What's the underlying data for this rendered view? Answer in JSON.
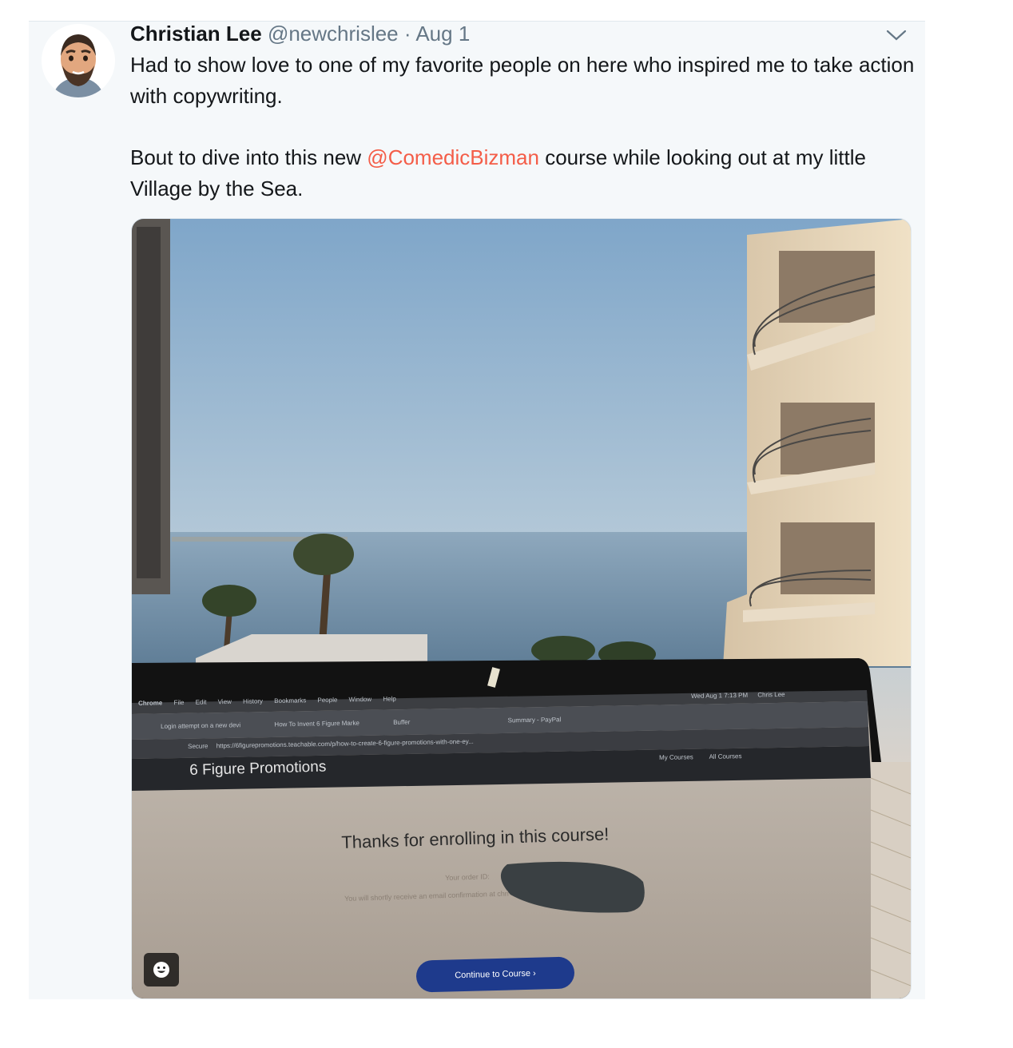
{
  "tweet": {
    "author_name": "Christian Lee",
    "author_handle": "@newchrislee",
    "separator": "·",
    "date": "Aug 1",
    "text_line1": "Had to show love to one of my favorite people on here who inspired me to take action with copywriting.",
    "text_line2_before": "Bout to dive into this new ",
    "mention": "@ComedicBizman",
    "text_line2_after": " course while looking out at my little Village by the Sea.",
    "mention_color": "#f45d48",
    "caret_icon": "chevron-down-icon",
    "emoji_icon": "smiley-face-icon"
  },
  "photo": {
    "site_title": "6 Figure Promotions",
    "heading": "Thanks for enrolling in this course!",
    "order_label": "Your order ID:",
    "confirmation_text": "You will shortly receive an email confirmation at chri",
    "button_label": "Continue to Course ›",
    "nav_my_courses": "My Courses",
    "nav_all_courses": "All Courses",
    "menu_items": [
      "Chrome",
      "File",
      "Edit",
      "View",
      "History",
      "Bookmarks",
      "People",
      "Window",
      "Help"
    ],
    "clock": "Wed Aug 1  7:13 PM",
    "user": "Chris Lee",
    "tab1": "Login attempt on a new devi",
    "tab2": "How To Invent 6 Figure Marke",
    "tab3": "Buffer",
    "tab4": "Summary - PayPal",
    "secure_label": "Secure",
    "url": "https://6figurepromotions.teachable.com/p/how-to-create-6-figure-promotions-with-one-ey..."
  }
}
